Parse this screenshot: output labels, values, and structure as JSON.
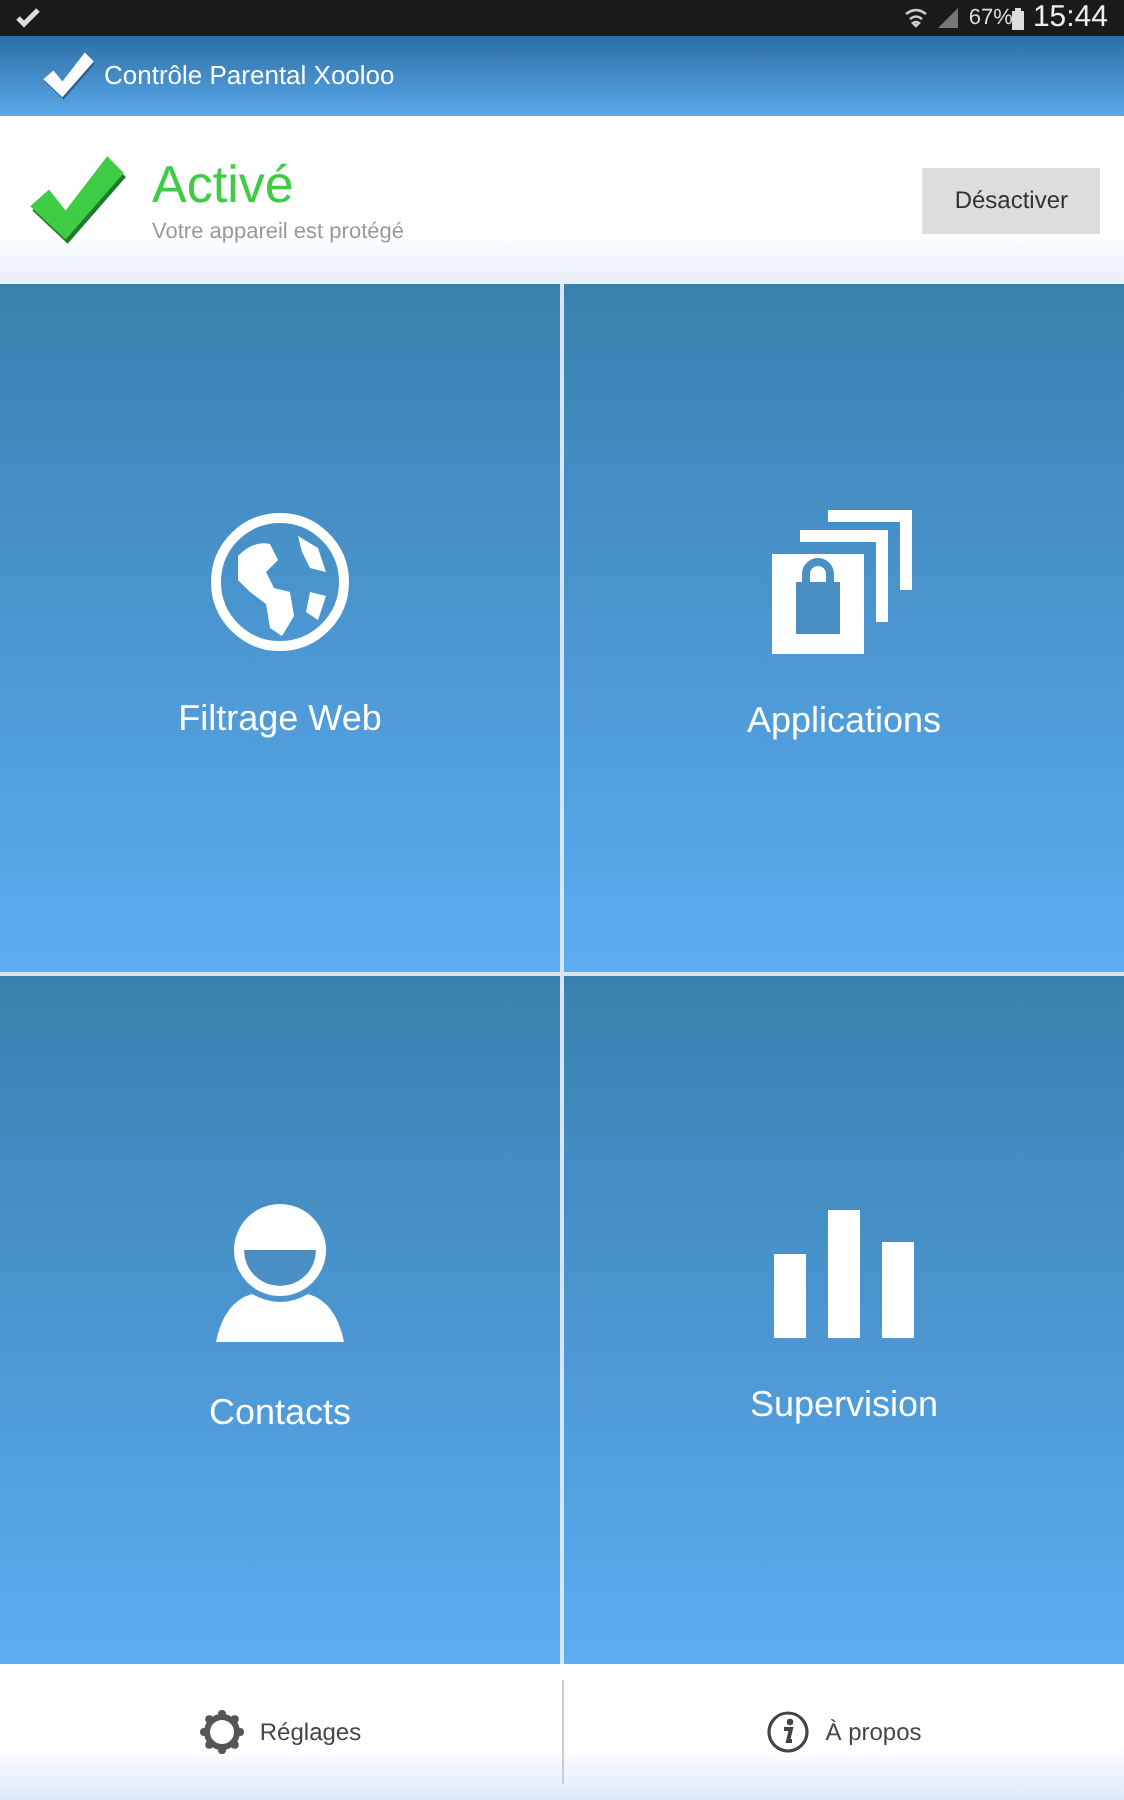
{
  "status_bar": {
    "battery": "67%",
    "time": "15:44"
  },
  "app_bar": {
    "title": "Contrôle Parental Xooloo"
  },
  "protection": {
    "title": "Activé",
    "subtitle": "Votre appareil est protégé",
    "button": "Désactiver"
  },
  "tiles": [
    {
      "kind": "globe",
      "label": "Filtrage Web"
    },
    {
      "kind": "apps",
      "label": "Applications"
    },
    {
      "kind": "person",
      "label": "Contacts"
    },
    {
      "kind": "chart",
      "label": "Supervision"
    }
  ],
  "footer": [
    {
      "kind": "gear",
      "label": "Réglages"
    },
    {
      "kind": "info",
      "label": "À propos"
    }
  ]
}
